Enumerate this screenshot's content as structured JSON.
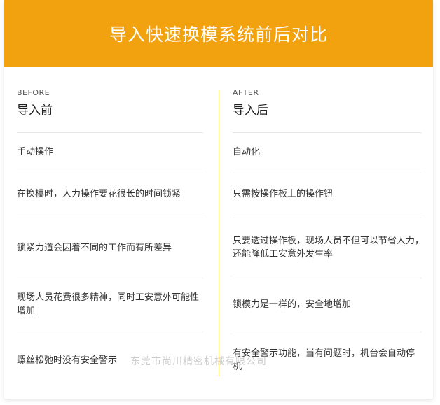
{
  "header": {
    "title": "导入快速换模系统前后对比"
  },
  "before": {
    "label_en": "BEFORE",
    "label_zh": "导入前",
    "items": [
      "手动操作",
      "在换模时，人力操作要花很长的时间锁紧",
      "锁紧力道会因着不同的工作而有所差异",
      "现场人员花费很多精神，同时工安意外可能性增加",
      "螺丝松弛时没有安全警示"
    ]
  },
  "after": {
    "label_en": "AFTER",
    "label_zh": "导入后",
    "items": [
      "自动化",
      "只需按操作板上的操作钮",
      "只要透过操作板，现场人员不但可以节省人力，还能降低工安意外发生率",
      "锁模力是一样的，安全地增加",
      "有安全警示功能，当有问题时，机台会自动停机"
    ]
  },
  "watermark": "东莞市尚川精密机械有限公司",
  "colors": {
    "accent": "#F3A20F",
    "divider": "#F0B64A"
  }
}
